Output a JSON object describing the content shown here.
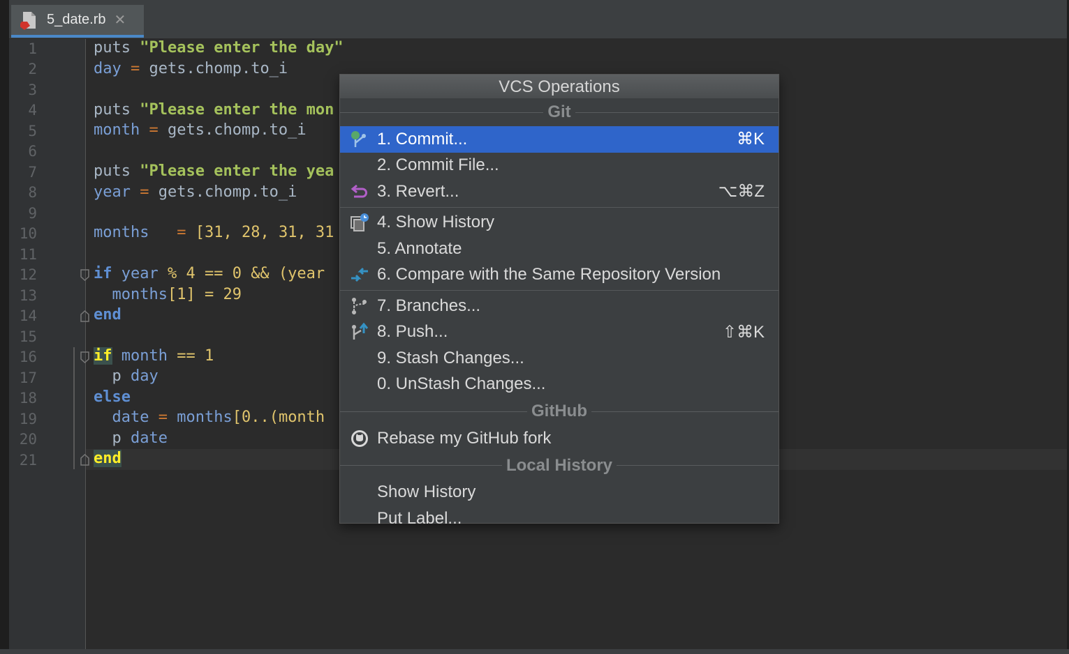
{
  "tab": {
    "filename": "5_date.rb",
    "close": "✕"
  },
  "line_numbers": [
    "1",
    "2",
    "3",
    "4",
    "5",
    "6",
    "7",
    "8",
    "9",
    "10",
    "11",
    "12",
    "13",
    "14",
    "15",
    "16",
    "17",
    "18",
    "19",
    "20",
    "21"
  ],
  "code": {
    "l1_kw": "puts",
    "l1_str": "\"Please enter the day\"",
    "l2_var": "day",
    "l2_op": "=",
    "l2_rest": "gets.chomp.to_i",
    "l4_kw": "puts",
    "l4_str": "\"Please enter the mon",
    "l5_var": "month",
    "l5_op": "=",
    "l5_rest": "gets.chomp.to_i",
    "l7_kw": "puts",
    "l7_str": "\"Please enter the yea",
    "l8_var": "year",
    "l8_op": "=",
    "l8_rest": "gets.chomp.to_i",
    "l10_var": "months",
    "l10_op": "=",
    "l10_rest": "[31, 28, 31, 31",
    "l12_kw": "if",
    "l12_var": "year",
    "l12_rest": "% 4 == 0 && (year",
    "l13_var": "months",
    "l13_rest": "[1] = 29",
    "l14_kw": "end",
    "l16_kw": "if",
    "l16_var": "month",
    "l16_rest": "== 1",
    "l17_kw": "p",
    "l17_var": "day",
    "l18_kw": "else",
    "l19_var": "date",
    "l19_op": "=",
    "l19_var2": "months",
    "l19_rest": "[0..(month",
    "l20_kw": "p",
    "l20_var": "date",
    "l21_kw": "end"
  },
  "popup": {
    "title": "VCS Operations",
    "groups": {
      "git": "Git",
      "github": "GitHub",
      "local_history": "Local History"
    },
    "items": {
      "commit": {
        "label": "1. Commit...",
        "shortcut": "⌘K",
        "icon": "commit-icon"
      },
      "commit_file": {
        "label": "2. Commit File..."
      },
      "revert": {
        "label": "3. Revert...",
        "shortcut": "⌥⌘Z",
        "icon": "revert-icon"
      },
      "show_history": {
        "label": "4. Show History",
        "icon": "history-icon"
      },
      "annotate": {
        "label": "5. Annotate"
      },
      "compare": {
        "label": "6. Compare with the Same Repository Version",
        "icon": "compare-icon"
      },
      "branches": {
        "label": "7. Branches...",
        "icon": "branches-icon"
      },
      "push": {
        "label": "8. Push...",
        "shortcut": "⇧⌘K",
        "icon": "push-icon"
      },
      "stash": {
        "label": "9. Stash Changes..."
      },
      "unstash": {
        "label": "0. UnStash Changes..."
      },
      "rebase": {
        "label": "Rebase my GitHub fork",
        "icon": "github-icon"
      },
      "lh_show_history": {
        "label": "Show History"
      },
      "put_label": {
        "label": "Put Label..."
      }
    }
  },
  "colors": {
    "selection": "#2f65ca",
    "editor_bg": "#2b2b2b",
    "popup_bg": "#3c3f41"
  }
}
